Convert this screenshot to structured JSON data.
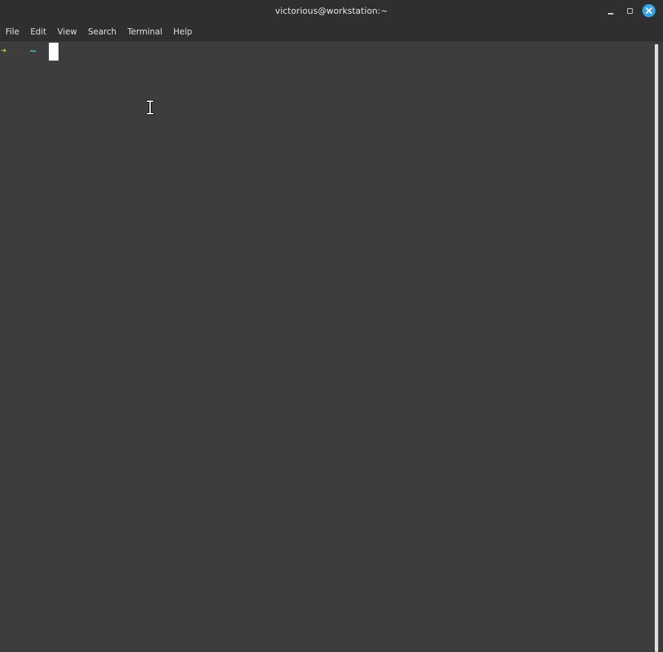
{
  "window": {
    "title": "victorious@workstation:~",
    "accent_color": "#36a4e6",
    "controls": {
      "minimize_icon": "minimize-icon",
      "maximize_icon": "maximize-icon",
      "close_icon": "close-icon"
    }
  },
  "menu": {
    "items": [
      {
        "label": "File"
      },
      {
        "label": "Edit"
      },
      {
        "label": "View"
      },
      {
        "label": "Search"
      },
      {
        "label": "Terminal"
      },
      {
        "label": "Help"
      }
    ]
  },
  "terminal": {
    "prompt_symbol": "➜",
    "prompt_directory": "~",
    "prompt_symbol_color": "#8fcf3a",
    "prompt_directory_color": "#3fc6c6",
    "background_color": "#3d3d3d",
    "mouse_pointer_icon": "ibeam-cursor-icon"
  }
}
